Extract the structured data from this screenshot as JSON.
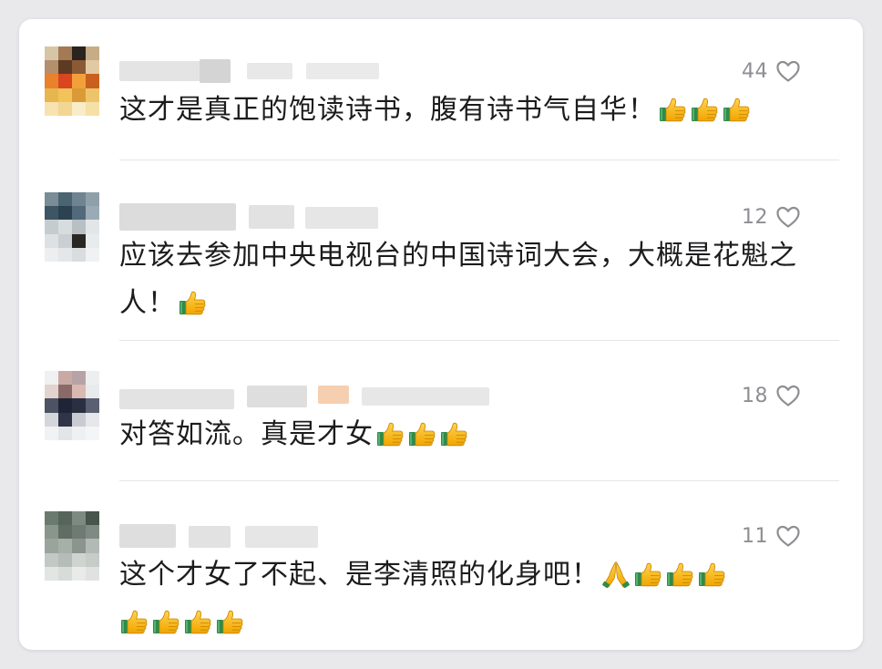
{
  "comments": [
    {
      "likes": "44",
      "text": "这才是真正的饱读诗书，腹有诗书气自华！",
      "emoji": [
        "thumbs-up",
        "thumbs-up",
        "thumbs-up"
      ]
    },
    {
      "likes": "12",
      "text": "应该去参加中央电视台的中国诗词大会，大概是花魁之人！",
      "emoji": [
        "thumbs-up"
      ]
    },
    {
      "likes": "18",
      "text": "对答如流。真是才女",
      "emoji": [
        "thumbs-up",
        "thumbs-up",
        "thumbs-up"
      ]
    },
    {
      "likes": "11",
      "text": "这个才女了不起、是李清照的化身吧！",
      "emoji": [
        "folded-hands",
        "thumbs-up",
        "thumbs-up",
        "thumbs-up",
        "thumbs-up",
        "thumbs-up",
        "thumbs-up",
        "thumbs-up"
      ]
    }
  ],
  "icons": {
    "like": "heart-outline-icon",
    "thumbs": "thumbs-up-icon",
    "pray": "folded-hands-icon"
  },
  "colors": {
    "like_count": "#8e8e93",
    "text": "#1c1c1e",
    "thumb_yellow": "#f5b400",
    "cuff_green": "#2e8b4a"
  }
}
